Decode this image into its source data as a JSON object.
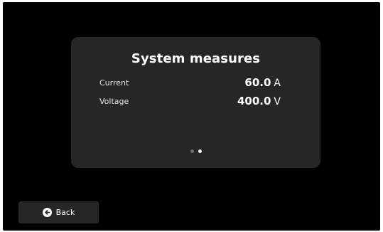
{
  "card": {
    "title": "System measures",
    "rows": [
      {
        "label": "Current",
        "value": "60.0",
        "unit": "A"
      },
      {
        "label": "Voltage",
        "value": "400.0",
        "unit": "V"
      }
    ],
    "pagination": {
      "pages": 2,
      "active_page": 2
    }
  },
  "footer": {
    "back_label": "Back",
    "back_icon": "arrow-left-circle-icon"
  },
  "colors": {
    "background": "#000000",
    "card": "#262626",
    "text": "#ffffff",
    "dot_inactive": "#6b6b6b",
    "dot_active": "#ffffff"
  }
}
